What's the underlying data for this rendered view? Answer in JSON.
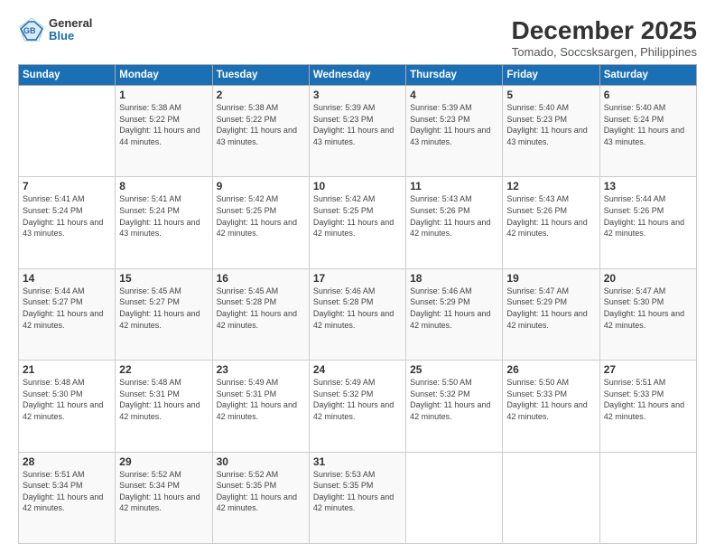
{
  "logo": {
    "general": "General",
    "blue": "Blue"
  },
  "title": "December 2025",
  "subtitle": "Tomado, Soccsksargen, Philippines",
  "days": [
    "Sunday",
    "Monday",
    "Tuesday",
    "Wednesday",
    "Thursday",
    "Friday",
    "Saturday"
  ],
  "weeks": [
    [
      {
        "day": "",
        "sunrise": "",
        "sunset": "",
        "daylight": ""
      },
      {
        "day": "1",
        "sunrise": "Sunrise: 5:38 AM",
        "sunset": "Sunset: 5:22 PM",
        "daylight": "Daylight: 11 hours and 44 minutes."
      },
      {
        "day": "2",
        "sunrise": "Sunrise: 5:38 AM",
        "sunset": "Sunset: 5:22 PM",
        "daylight": "Daylight: 11 hours and 43 minutes."
      },
      {
        "day": "3",
        "sunrise": "Sunrise: 5:39 AM",
        "sunset": "Sunset: 5:23 PM",
        "daylight": "Daylight: 11 hours and 43 minutes."
      },
      {
        "day": "4",
        "sunrise": "Sunrise: 5:39 AM",
        "sunset": "Sunset: 5:23 PM",
        "daylight": "Daylight: 11 hours and 43 minutes."
      },
      {
        "day": "5",
        "sunrise": "Sunrise: 5:40 AM",
        "sunset": "Sunset: 5:23 PM",
        "daylight": "Daylight: 11 hours and 43 minutes."
      },
      {
        "day": "6",
        "sunrise": "Sunrise: 5:40 AM",
        "sunset": "Sunset: 5:24 PM",
        "daylight": "Daylight: 11 hours and 43 minutes."
      }
    ],
    [
      {
        "day": "7",
        "sunrise": "Sunrise: 5:41 AM",
        "sunset": "Sunset: 5:24 PM",
        "daylight": "Daylight: 11 hours and 43 minutes."
      },
      {
        "day": "8",
        "sunrise": "Sunrise: 5:41 AM",
        "sunset": "Sunset: 5:24 PM",
        "daylight": "Daylight: 11 hours and 43 minutes."
      },
      {
        "day": "9",
        "sunrise": "Sunrise: 5:42 AM",
        "sunset": "Sunset: 5:25 PM",
        "daylight": "Daylight: 11 hours and 42 minutes."
      },
      {
        "day": "10",
        "sunrise": "Sunrise: 5:42 AM",
        "sunset": "Sunset: 5:25 PM",
        "daylight": "Daylight: 11 hours and 42 minutes."
      },
      {
        "day": "11",
        "sunrise": "Sunrise: 5:43 AM",
        "sunset": "Sunset: 5:26 PM",
        "daylight": "Daylight: 11 hours and 42 minutes."
      },
      {
        "day": "12",
        "sunrise": "Sunrise: 5:43 AM",
        "sunset": "Sunset: 5:26 PM",
        "daylight": "Daylight: 11 hours and 42 minutes."
      },
      {
        "day": "13",
        "sunrise": "Sunrise: 5:44 AM",
        "sunset": "Sunset: 5:26 PM",
        "daylight": "Daylight: 11 hours and 42 minutes."
      }
    ],
    [
      {
        "day": "14",
        "sunrise": "Sunrise: 5:44 AM",
        "sunset": "Sunset: 5:27 PM",
        "daylight": "Daylight: 11 hours and 42 minutes."
      },
      {
        "day": "15",
        "sunrise": "Sunrise: 5:45 AM",
        "sunset": "Sunset: 5:27 PM",
        "daylight": "Daylight: 11 hours and 42 minutes."
      },
      {
        "day": "16",
        "sunrise": "Sunrise: 5:45 AM",
        "sunset": "Sunset: 5:28 PM",
        "daylight": "Daylight: 11 hours and 42 minutes."
      },
      {
        "day": "17",
        "sunrise": "Sunrise: 5:46 AM",
        "sunset": "Sunset: 5:28 PM",
        "daylight": "Daylight: 11 hours and 42 minutes."
      },
      {
        "day": "18",
        "sunrise": "Sunrise: 5:46 AM",
        "sunset": "Sunset: 5:29 PM",
        "daylight": "Daylight: 11 hours and 42 minutes."
      },
      {
        "day": "19",
        "sunrise": "Sunrise: 5:47 AM",
        "sunset": "Sunset: 5:29 PM",
        "daylight": "Daylight: 11 hours and 42 minutes."
      },
      {
        "day": "20",
        "sunrise": "Sunrise: 5:47 AM",
        "sunset": "Sunset: 5:30 PM",
        "daylight": "Daylight: 11 hours and 42 minutes."
      }
    ],
    [
      {
        "day": "21",
        "sunrise": "Sunrise: 5:48 AM",
        "sunset": "Sunset: 5:30 PM",
        "daylight": "Daylight: 11 hours and 42 minutes."
      },
      {
        "day": "22",
        "sunrise": "Sunrise: 5:48 AM",
        "sunset": "Sunset: 5:31 PM",
        "daylight": "Daylight: 11 hours and 42 minutes."
      },
      {
        "day": "23",
        "sunrise": "Sunrise: 5:49 AM",
        "sunset": "Sunset: 5:31 PM",
        "daylight": "Daylight: 11 hours and 42 minutes."
      },
      {
        "day": "24",
        "sunrise": "Sunrise: 5:49 AM",
        "sunset": "Sunset: 5:32 PM",
        "daylight": "Daylight: 11 hours and 42 minutes."
      },
      {
        "day": "25",
        "sunrise": "Sunrise: 5:50 AM",
        "sunset": "Sunset: 5:32 PM",
        "daylight": "Daylight: 11 hours and 42 minutes."
      },
      {
        "day": "26",
        "sunrise": "Sunrise: 5:50 AM",
        "sunset": "Sunset: 5:33 PM",
        "daylight": "Daylight: 11 hours and 42 minutes."
      },
      {
        "day": "27",
        "sunrise": "Sunrise: 5:51 AM",
        "sunset": "Sunset: 5:33 PM",
        "daylight": "Daylight: 11 hours and 42 minutes."
      }
    ],
    [
      {
        "day": "28",
        "sunrise": "Sunrise: 5:51 AM",
        "sunset": "Sunset: 5:34 PM",
        "daylight": "Daylight: 11 hours and 42 minutes."
      },
      {
        "day": "29",
        "sunrise": "Sunrise: 5:52 AM",
        "sunset": "Sunset: 5:34 PM",
        "daylight": "Daylight: 11 hours and 42 minutes."
      },
      {
        "day": "30",
        "sunrise": "Sunrise: 5:52 AM",
        "sunset": "Sunset: 5:35 PM",
        "daylight": "Daylight: 11 hours and 42 minutes."
      },
      {
        "day": "31",
        "sunrise": "Sunrise: 5:53 AM",
        "sunset": "Sunset: 5:35 PM",
        "daylight": "Daylight: 11 hours and 42 minutes."
      },
      {
        "day": "",
        "sunrise": "",
        "sunset": "",
        "daylight": ""
      },
      {
        "day": "",
        "sunrise": "",
        "sunset": "",
        "daylight": ""
      },
      {
        "day": "",
        "sunrise": "",
        "sunset": "",
        "daylight": ""
      }
    ]
  ]
}
